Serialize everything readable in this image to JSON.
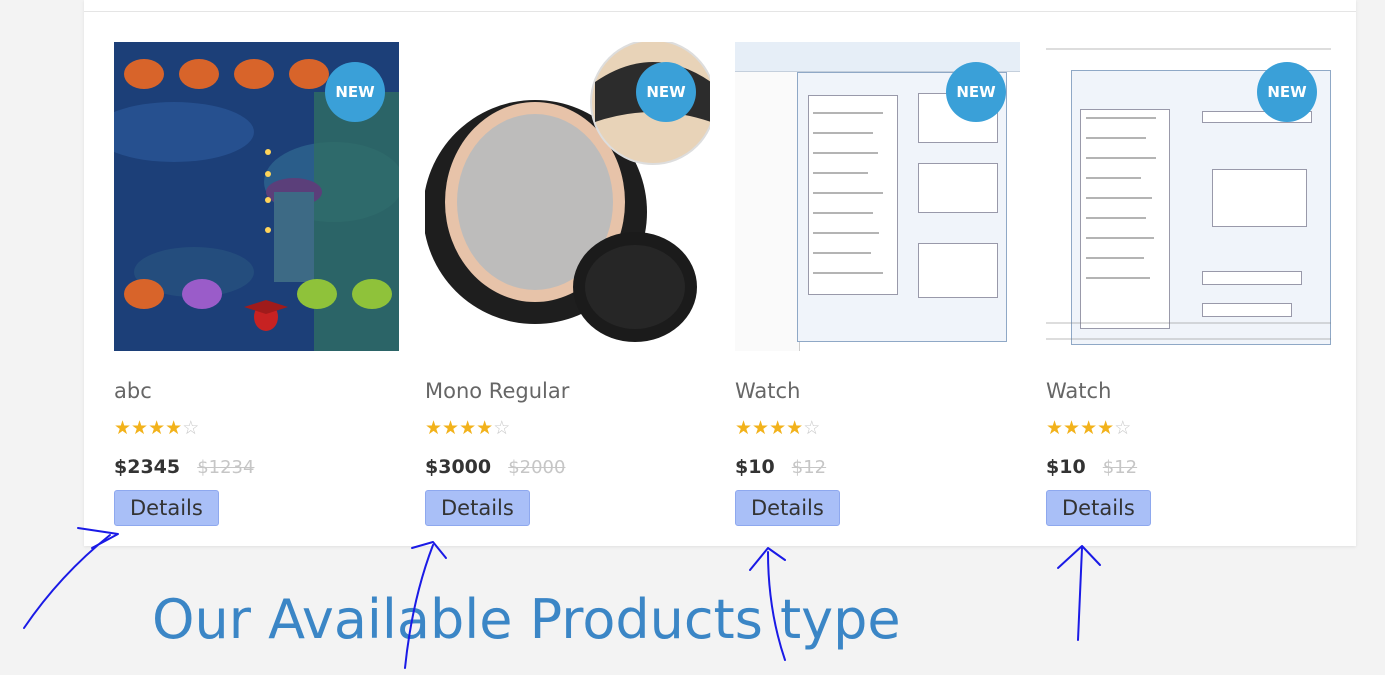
{
  "badge_text": "NEW",
  "products": [
    {
      "name": "abc",
      "rating": 4,
      "max_rating": 5,
      "price": "$2345",
      "old_price": "$1234",
      "button": "Details",
      "image": "monster-game-screenshot"
    },
    {
      "name": "Mono Regular",
      "rating": 4,
      "max_rating": 5,
      "price": "$3000",
      "old_price": "$2000",
      "button": "Details",
      "image": "hair-system-photo"
    },
    {
      "name": "Watch",
      "rating": 4,
      "max_rating": 5,
      "price": "$10",
      "old_price": "$12",
      "button": "Details",
      "image": "spss-dialog-screenshot"
    },
    {
      "name": "Watch",
      "rating": 4,
      "max_rating": 5,
      "price": "$10",
      "old_price": "$12",
      "button": "Details",
      "image": "spss-regression-screenshot"
    }
  ],
  "section_heading": "Our Available Products type",
  "colors": {
    "badge": "#3aa0d8",
    "button": "#a9bff7",
    "star": "#f2b21b",
    "heading": "#3b86c6",
    "annotation": "#1a1ae6"
  }
}
